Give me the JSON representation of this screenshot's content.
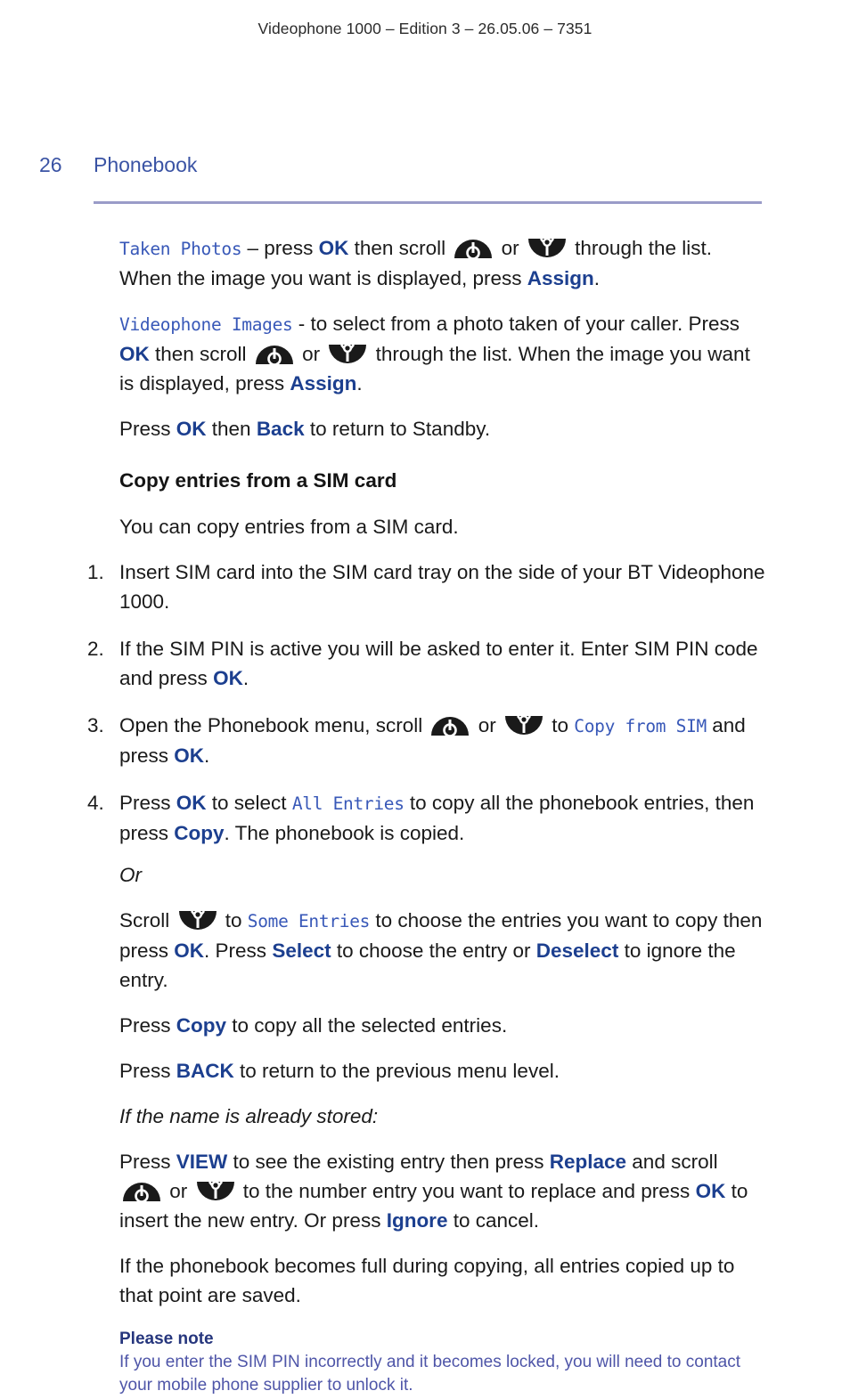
{
  "header": {
    "running_head": "Videophone 1000 – Edition 3 – 26.05.06 – 7351"
  },
  "page": {
    "folio": "26",
    "section_title": "Phonebook"
  },
  "icons": {
    "scroll_up": "rocker-up-icon",
    "scroll_down": "rocker-down-icon"
  },
  "colors": {
    "section_blue": "#3a53a4",
    "softkey_blue": "#1c3f8f",
    "lcd_blue": "#3858b8",
    "rule": "#9a9cc8",
    "note_title": "#26367d",
    "note_body": "#4e55a8",
    "body_text": "#1a1a1a"
  },
  "body": {
    "p_taken_photos": {
      "lcd_term": "Taken Photos",
      "t1": " – press ",
      "k1": "OK",
      "t2": " then scroll ",
      "t3": " or ",
      "t4": " through the list. When the image you want is displayed, press ",
      "k2": "Assign",
      "t5": "."
    },
    "p_videophone_images": {
      "lcd_term": "Videophone Images",
      "t1": " - to select from a photo taken of your caller. Press ",
      "k1": "OK",
      "t2": " then scroll ",
      "t3": " or ",
      "t4": " through the list. When the image you want is displayed, press ",
      "k2": "Assign",
      "t5": "."
    },
    "p_standby": {
      "t1": "Press ",
      "k1": "OK",
      "t2": " then ",
      "k2": "Back",
      "t3": " to return to Standby."
    },
    "subhead": "Copy entries from a SIM card",
    "p_intro": "You can copy entries from a SIM card.",
    "steps": [
      {
        "num": "1.",
        "t1": "Insert SIM card into the SIM card tray on the side of your BT Videophone 1000."
      },
      {
        "num": "2.",
        "t1": "If the SIM PIN is active you will be asked to enter it. Enter SIM PIN code and press ",
        "k1": "OK",
        "t2": "."
      },
      {
        "num": "3.",
        "t1": "Open the Phonebook menu, scroll ",
        "t2": " or ",
        "t3": " to ",
        "lcd1": "Copy from SIM",
        "t4": " and press ",
        "k1": "OK",
        "t5": "."
      },
      {
        "num": "4.",
        "t1": "Press ",
        "k1": "OK",
        "t2": " to select ",
        "lcd1": "All Entries",
        "t3": " to copy all the phonebook entries, then press ",
        "k2": "Copy",
        "t4": ". The phonebook is copied.",
        "or_label": "Or",
        "s1_t1": "Scroll ",
        "s1_t2": " to ",
        "s1_lcd": "Some Entries",
        "s1_t3": " to choose the entries you want to copy then press ",
        "s1_k1": "OK",
        "s1_t4": ". Press ",
        "s1_k2": "Select",
        "s1_t5": " to choose the entry or ",
        "s1_k3": "Deselect",
        "s1_t6": " to ignore the entry.",
        "s2_t1": "Press ",
        "s2_k1": "Copy",
        "s2_t2": " to copy all the selected entries.",
        "s3_t1": "Press ",
        "s3_k1": "BACK",
        "s3_t2": " to return to the previous menu level.",
        "s4_ital": "If the name is already stored:",
        "s5_t1": "Press ",
        "s5_k1": "VIEW",
        "s5_t2": " to see the existing entry then press ",
        "s5_k2": "Replace",
        "s5_t3": " and scroll ",
        "s5_t4": " or ",
        "s5_t5": " to the number entry you want to replace and press ",
        "s5_k3": "OK",
        "s5_t6": " to insert the new entry. Or press ",
        "s5_k4": "Ignore",
        "s5_t7": " to cancel.",
        "s6_t1": "If the phonebook becomes full during copying, all entries copied up to that point are saved."
      }
    ],
    "note": {
      "title": "Please note",
      "body": "If you enter the SIM PIN incorrectly and it becomes locked, you will need to contact your mobile phone supplier to unlock it."
    }
  }
}
